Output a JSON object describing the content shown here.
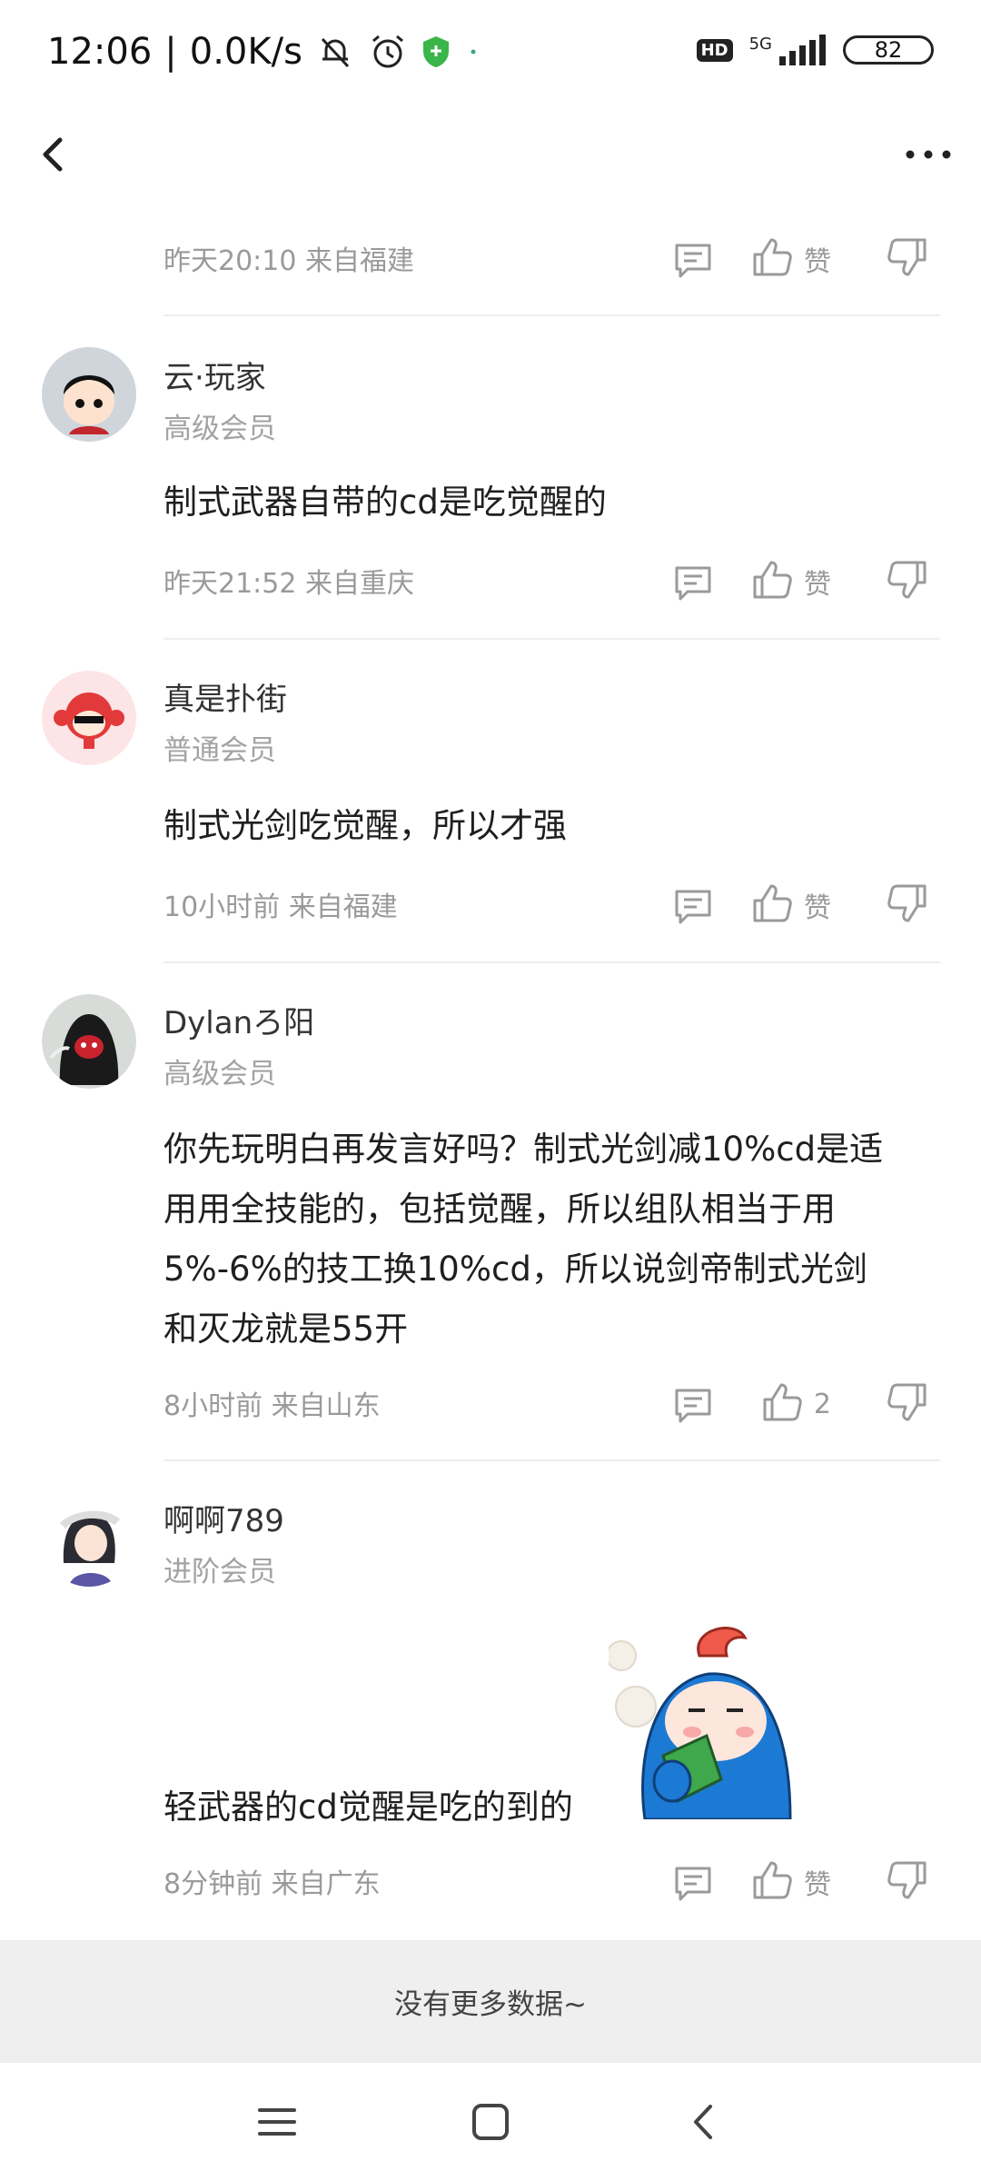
{
  "status_bar": {
    "time": "12:06",
    "speed": "0.0K/s",
    "network": "5G",
    "hd": "HD",
    "battery": "82"
  },
  "comments": [
    {
      "meta": "昨天20:10 来自福建",
      "like_label": "赞"
    },
    {
      "username": "云·玩家",
      "level": "高级会员",
      "text": "制式武器自带的cd是吃觉醒的",
      "meta": "昨天21:52 来自重庆",
      "like_label": "赞"
    },
    {
      "username": "真是扑街",
      "level": "普通会员",
      "text": "制式光剑吃觉醒，所以才强",
      "meta": "10小时前 来自福建",
      "like_label": "赞"
    },
    {
      "username": "Dylanろ阳",
      "level": "高级会员",
      "text_lines": [
        "你先玩明白再发言好吗？制式光剑减10%cd是适",
        "用用全技能的，包括觉醒，所以组队相当于用",
        "5%-6%的技工换10%cd，所以说剑帝制式光剑",
        "和灭龙就是55开"
      ],
      "meta": "8小时前 来自山东",
      "like_label": "2"
    },
    {
      "username": "啊啊789",
      "level": "进阶会员",
      "text": "轻武器的cd觉醒是吃的到的",
      "meta": "8分钟前 来自广东",
      "like_label": "赞"
    }
  ],
  "footer": {
    "no_more": "没有更多数据~"
  },
  "colors": {
    "meta": "#9a9a9a",
    "divider": "#eeeeee",
    "footer_bg": "#efefef"
  }
}
